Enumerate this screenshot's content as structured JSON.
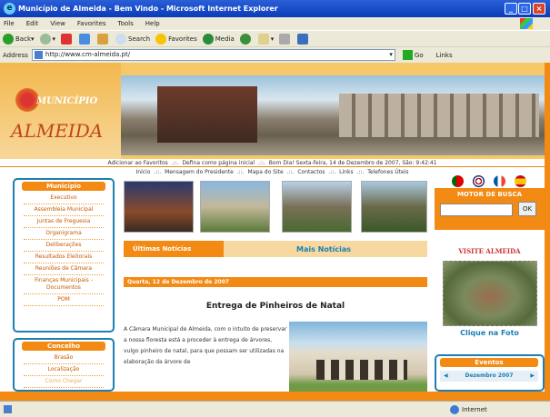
{
  "window": {
    "title": "Município de Almeida - Bem Vindo - Microsoft Internet Explorer"
  },
  "menubar": {
    "items": [
      "File",
      "Edit",
      "View",
      "Favorites",
      "Tools",
      "Help"
    ]
  },
  "toolbar": {
    "back": "Back",
    "search": "Search",
    "favorites": "Favorites",
    "media": "Media"
  },
  "address": {
    "label": "Address",
    "url": "http://www.cm-almeida.pt/",
    "go": "Go",
    "links": "Links"
  },
  "header": {
    "logo_sub": "MUNICÍPIO",
    "logo_main": "ALMEIDA"
  },
  "marquee1": [
    "Adicionar ao Favoritos",
    "Defina como página inicial",
    "Bom Dia! Sexta-feira, 14 de Dezembro de 2007, São: 9:42:41"
  ],
  "marquee2": [
    "Início",
    "Mensagem do Presidente",
    "Mapa do Site",
    "Contactos",
    "Links",
    "Telefones Úteis"
  ],
  "menu_municipio": {
    "title": "Município",
    "items": [
      "Executivo",
      "Assembleia Municipal",
      "Juntas de Freguesia",
      "Organigrama",
      "Deliberações",
      "Resultados Eleitorais",
      "Reuniões de Câmara",
      "Finanças Municipais - Documentos",
      "POM"
    ]
  },
  "menu_concelho": {
    "title": "Concelho",
    "items": [
      "Brasão",
      "Localização",
      "Como Chegar"
    ]
  },
  "tabs": {
    "ultimas": "Últimas Notícias",
    "mais": "Mais Notícias"
  },
  "news": {
    "date": "Quarta, 12 de Dezembro de 2007",
    "title": "Entrega de Pinheiros de Natal",
    "text": "A Câmara Municipal de Almeida, com o intuito de preservar a nossa floresta está a proceder à entrega de árvores, vulgo pinheiro de natal, para que possam ser utilizadas na elaboração da árvore de"
  },
  "search": {
    "title": "MOTOR DE BUSCA",
    "button": "OK"
  },
  "visite": "VISITE ALMEIDA",
  "clique": "Clique na Foto",
  "eventos": {
    "title": "Eventos",
    "month": "Dezembro 2007"
  },
  "status": {
    "zone": "Internet"
  },
  "colors": {
    "accent": "#f28a13",
    "blue": "#1c7fb3",
    "title": "#0a3cb8"
  }
}
